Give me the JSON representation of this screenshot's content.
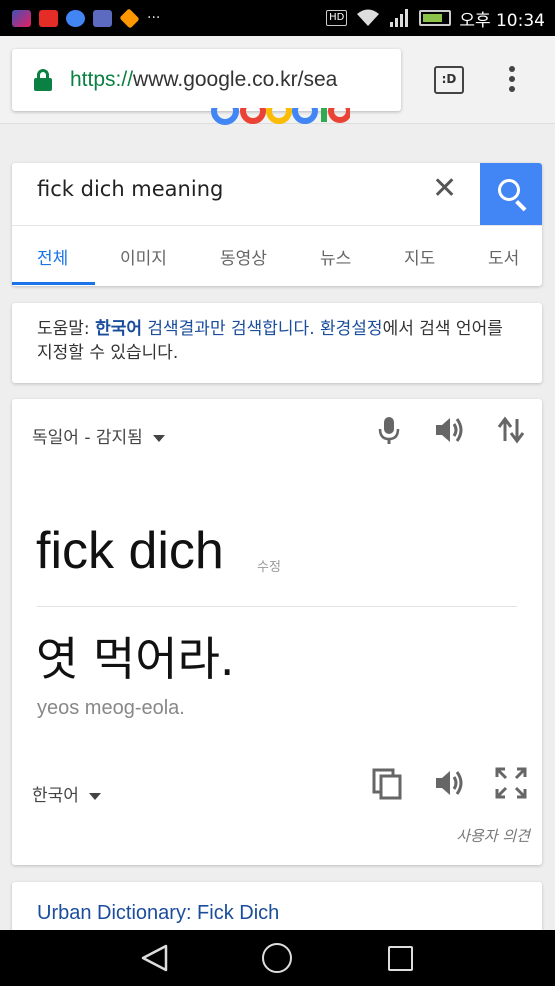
{
  "status_bar": {
    "icons": [
      "gallery-icon",
      "youtube-icon",
      "google-icon",
      "app-icon",
      "game-icon"
    ],
    "overflow": "···",
    "hd_badge": "HD",
    "time": "오후 10:34",
    "colors": {
      "youtube": "#e52d27",
      "google": "#4285f4",
      "app": "#5c6bc0",
      "game": "#ff9800"
    }
  },
  "browser": {
    "url_scheme": "https://",
    "url_rest": "www.google.co.kr/sea",
    "tab_count": ":D"
  },
  "search": {
    "query": "fick dich meaning",
    "tabs": [
      "전체",
      "이미지",
      "동영상",
      "뉴스",
      "지도",
      "도서"
    ],
    "accent": "#4285f4"
  },
  "help": {
    "prefix": "도움말: ",
    "korean_link": "한국어",
    "mid_link": " 검색결과만 검색합니다. ",
    "settings_link": "환경설정",
    "suffix": "에서 검색 언어를 지정할 수 있습니다."
  },
  "translate": {
    "source_lang": "독일어 - 감지됨",
    "source_text": "fick dich",
    "edit_label": "수정",
    "target_text": "엿 먹어라.",
    "romanization": "yeos meog-eola.",
    "target_lang": "한국어",
    "feedback": "사용자 의견"
  },
  "result": {
    "title": "Urban Dictionary: Fick Dich"
  }
}
